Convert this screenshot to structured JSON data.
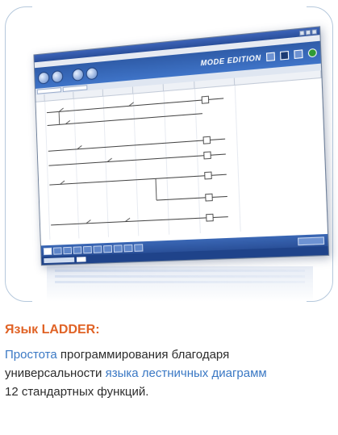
{
  "screenshot": {
    "title_bar": "",
    "menu_items": [
      "",
      "",
      "",
      "",
      "",
      "",
      "",
      ""
    ],
    "mode_label": "MODE EDITION",
    "colors": {
      "toolbar_blue": "#2f5ca8",
      "title_blue": "#2a4f9a",
      "heading_orange": "#e06326",
      "link_blue": "#3a78c4"
    },
    "icons": [
      "play-icon",
      "stop-icon",
      "mode-icon",
      "monitor-icon",
      "run-icon"
    ]
  },
  "text": {
    "heading": "Язык LADDER:",
    "line1_hl": "Простота",
    "line1_rest": " программирования благодаря",
    "line2_pre": "универсальности ",
    "line2_hl": "языка лестничных диаграмм",
    "line3": "12 стандартных функций."
  }
}
